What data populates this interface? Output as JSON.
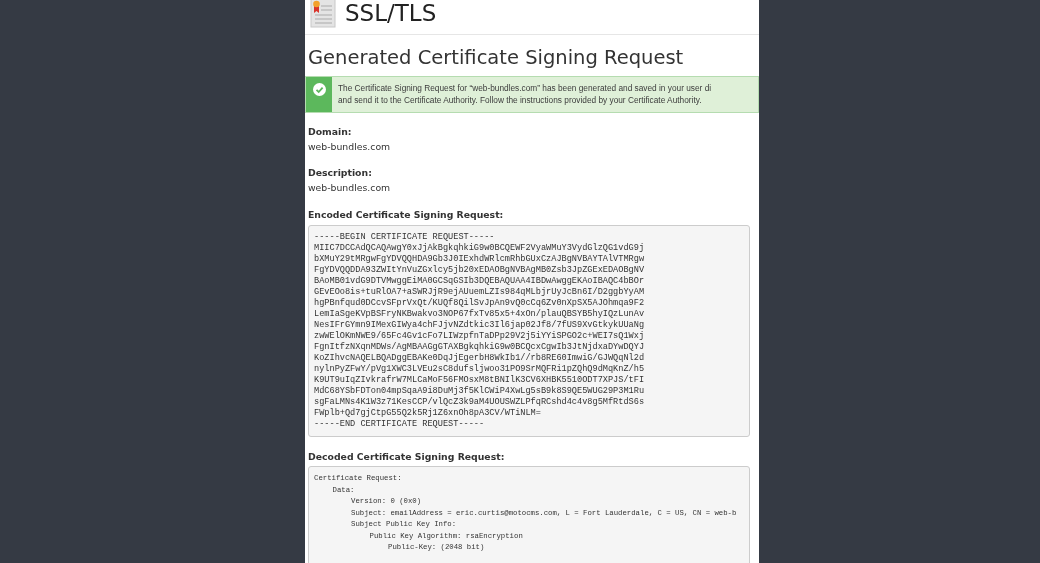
{
  "page_title": "SSL/TLS",
  "heading": "Generated Certificate Signing Request",
  "alert": {
    "kind": "success",
    "lines": [
      "The Certificate Signing Request for “web-bundles.com” has been generated and saved in your user di",
      "and send it to the Certificate Authority. Follow the instructions provided by your Certificate Authority."
    ]
  },
  "fields": [
    {
      "label": "Domain:",
      "value": "web-bundles.com"
    },
    {
      "label": "Description:",
      "value": "web-bundles.com"
    }
  ],
  "encoded": {
    "label": "Encoded Certificate Signing Request:",
    "lines": [
      "-----BEGIN CERTIFICATE REQUEST-----",
      "MIIC7DCCAdQCAQAwgY0xJjAkBgkqhkiG9w0BCQEWF2VyaWMuY3VydGlzQG1vdG9j",
      "bXMuY29tMRgwFgYDVQQHDA9Gb3J0IExhdWRlcmRhbGUxCzAJBgNVBAYTAlVTMRgw",
      "FgYDVQQDDA93ZWItYnVuZGxlcy5jb20xEDAOBgNVBAgMB0Zsb3JpZGExEDAOBgNV",
      "BAoMB01vdG9DTVMwggEiMA0GCSqGSIb3DQEBAQUAA4IBDwAwggEKAoIBAQC4bBOr",
      "GEvEOo8is+tuRlOA7+aSWRJjR9ejAUuemLZIs984qMLbjrUyJcBn6I/D2ggbYyAM",
      "hgPBnfqud0DCcvSFprVxQt/KUQf8QilSvJpAn9vQ0cCq6Zv0nXpSX5AJOhmqa9F2",
      "LemIaSgeKVpBSFryNKBwakvo3NOP67fxTv85x5+4xOn/plauQBSYB5hyIQzLunAv",
      "NesIFrGYmn9IMexGIWya4chFJjvNZdtkic3Il6jap02Jf8/7fUS9XvGtkykUUaNg",
      "zwWElOKmNWE9/65Fc4Gv1cFo7LIWzpfnTaDPp29V2j5iYYiSPGO2c+WEI7sQ1Wxj",
      "FgnItfzNXqnMDWs/AgMBAAGgGTAXBgkqhkiG9w0BCQcxCgwIb3JtNjdxaDYwDQYJ",
      "KoZIhvcNAQELBQADggEBAKe0DqJjEgerbH8WkIb1//rb8RE60ImwiG/GJWQqNl2d",
      "nylnPyZFwY/pVg1XWC3LVEu2sC8dufsljwoo31PO9SrMQFRi1pZQhQ9dMqKnZ/h5",
      "K9UT9uIqZIvkrafrW7MLCaMoF56FMOsxM8tBNIlK3CV6XHBK5510ODT7XPJS/tFI",
      "MdC68YSbFDTon04mpSqaA9i8DuMj3f5KlCWiP4XwLg5sB9k8S9QE5WUG29P3M1Ru",
      "sgFaLMNs4K1W3z71KesCCP/vlQcZ3k9aM4UOUSWZLPfqRCshd4c4v8g5MfRtdS6s",
      "FWplb+Qd7gjCtpG55Q2k5Rj1Z6xnOh8pA3CV/WTiNLM=",
      "-----END CERTIFICATE REQUEST-----"
    ]
  },
  "decoded": {
    "label": "Decoded Certificate Signing Request:",
    "tree": [
      {
        "text": "Certificate Request:",
        "children": [
          {
            "text": "Data:",
            "children": [
              {
                "text": "Version: 0 (0x0)"
              },
              {
                "text": "Subject: emailAddress = eric.curtis@motocms.com, L = Fort Lauderdale, C = US, CN = web-b"
              },
              {
                "text": "Subject Public Key Info:",
                "children": [
                  {
                    "text": "Public Key Algorithm: rsaEncryption",
                    "children": [
                      {
                        "text": "Public-Key: (2048 bit)"
                      }
                    ]
                  }
                ]
              }
            ]
          }
        ]
      }
    ]
  }
}
